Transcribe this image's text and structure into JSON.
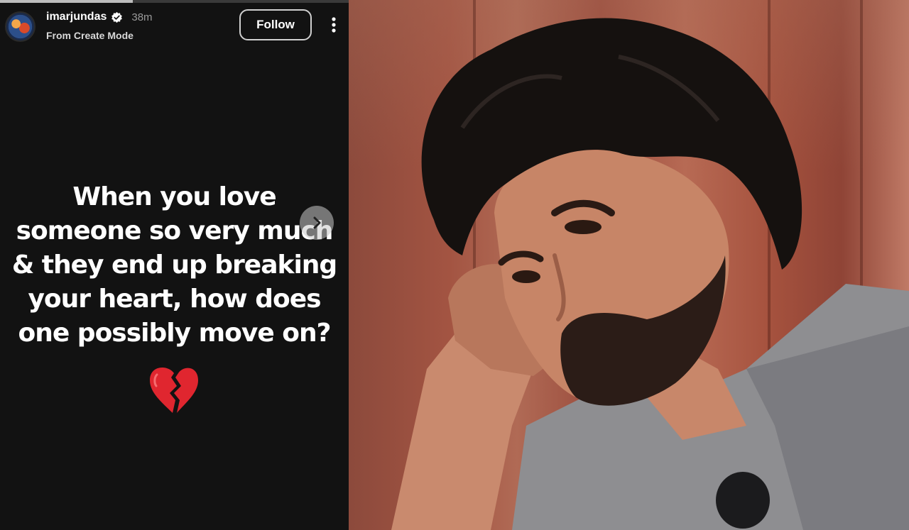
{
  "story": {
    "progress": 0.38,
    "username": "imarjundas",
    "verified": true,
    "time_ago": "38m",
    "subtitle": "From Create Mode",
    "follow_label": "Follow",
    "text_lines": [
      "When you love",
      "someone so very much",
      "& they end up breaking",
      "your heart, how does",
      "one possibly move on?"
    ],
    "emoji_name": "broken-heart-icon",
    "emoji_color": "#e0262f"
  },
  "photo": {
    "subject": "man-portrait",
    "wall_color": "#a35442"
  },
  "colors": {
    "background": "#121212",
    "text": "#ffffff",
    "muted": "#9a9a9a",
    "verified_badge": "#ffffff"
  }
}
